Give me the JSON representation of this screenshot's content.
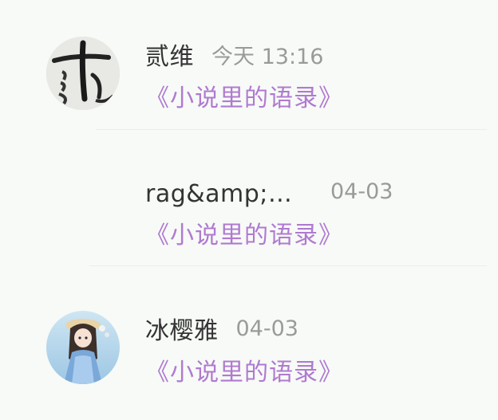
{
  "comments": [
    {
      "user": "贰维",
      "time": "今天 13:16",
      "book": "《小说里的语录》",
      "avatar": "calligraphy-avatar"
    },
    {
      "user": "rag&amp;扫b...",
      "time": "04-03",
      "book": "《小说里的语录》",
      "avatar": ""
    },
    {
      "user": "冰樱雅",
      "time": "04-03",
      "book": "《小说里的语录》",
      "avatar": "anime-girl-avatar"
    }
  ],
  "colors": {
    "background": "#f7faf7",
    "name": "#333333",
    "time": "#9a9a9a",
    "link": "#b07ad0"
  }
}
